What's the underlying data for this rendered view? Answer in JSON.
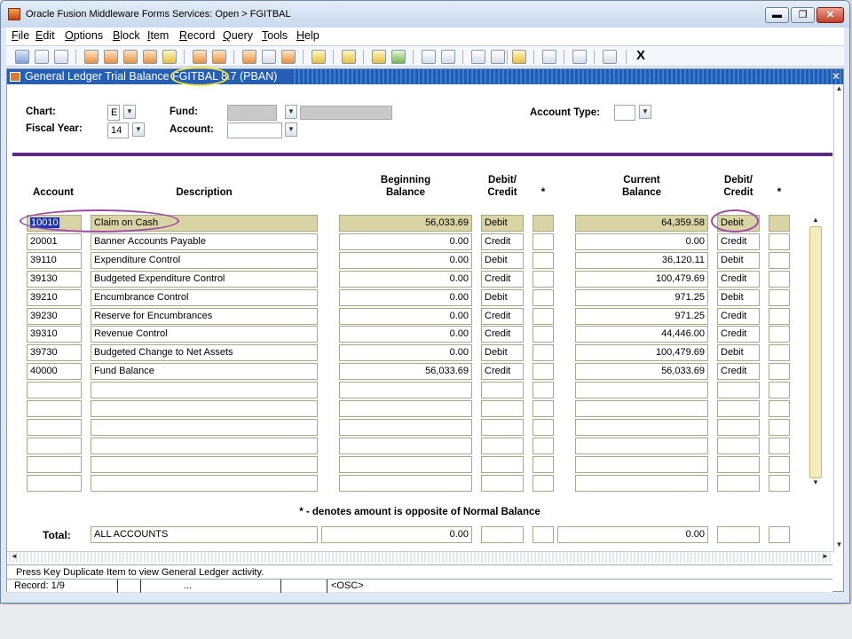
{
  "window": {
    "title": "Oracle Fusion Middleware Forms Services:  Open > FGITBAL",
    "min": "▬",
    "max": "❐",
    "close": "✕"
  },
  "menu": [
    "File",
    "Edit",
    "Options",
    "Block",
    "Item",
    "Record",
    "Query",
    "Tools",
    "Help"
  ],
  "toolbar": {
    "exit_label": "X"
  },
  "form": {
    "title": "General Ledger Trial Balance  FGITBAL  8.7  (PBAN)",
    "controls": "✕"
  },
  "header": {
    "chart_label": "Chart:",
    "chart_value": "E",
    "fiscal_year_label": "Fiscal Year:",
    "fiscal_year_value": "14",
    "fund_label": "Fund:",
    "fund_value": "",
    "fund_desc": "",
    "account_label": "Account:",
    "account_value": "",
    "account_type_label": "Account Type:",
    "account_type_value": ""
  },
  "columns": {
    "account": "Account",
    "description": "Description",
    "beginning_balance": "Beginning\nBalance",
    "debit_credit_1": "Debit/\nCredit",
    "star_1": "*",
    "current_balance": "Current\nBalance",
    "debit_credit_2": "Debit/\nCredit",
    "star_2": "*"
  },
  "rows": [
    {
      "account": "10010",
      "description": "Claim on Cash",
      "beg": "56,033.69",
      "dc1": "Debit",
      "cur": "64,359.58",
      "dc2": "Debit"
    },
    {
      "account": "20001",
      "description": "Banner Accounts Payable",
      "beg": "0.00",
      "dc1": "Credit",
      "cur": "0.00",
      "dc2": "Credit"
    },
    {
      "account": "39110",
      "description": "Expenditure Control",
      "beg": "0.00",
      "dc1": "Debit",
      "cur": "36,120.11",
      "dc2": "Debit"
    },
    {
      "account": "39130",
      "description": "Budgeted Expenditure Control",
      "beg": "0.00",
      "dc1": "Credit",
      "cur": "100,479.69",
      "dc2": "Credit"
    },
    {
      "account": "39210",
      "description": "Encumbrance Control",
      "beg": "0.00",
      "dc1": "Debit",
      "cur": "971.25",
      "dc2": "Debit"
    },
    {
      "account": "39230",
      "description": "Reserve for Encumbrances",
      "beg": "0.00",
      "dc1": "Credit",
      "cur": "971.25",
      "dc2": "Credit"
    },
    {
      "account": "39310",
      "description": "Revenue Control",
      "beg": "0.00",
      "dc1": "Credit",
      "cur": "44,446.00",
      "dc2": "Credit"
    },
    {
      "account": "39730",
      "description": "Budgeted Change to Net Assets",
      "beg": "0.00",
      "dc1": "Debit",
      "cur": "100,479.69",
      "dc2": "Debit"
    },
    {
      "account": "40000",
      "description": "Fund Balance",
      "beg": "56,033.69",
      "dc1": "Credit",
      "cur": "56,033.69",
      "dc2": "Credit"
    },
    {
      "account": "",
      "description": "",
      "beg": "",
      "dc1": "",
      "cur": "",
      "dc2": ""
    },
    {
      "account": "",
      "description": "",
      "beg": "",
      "dc1": "",
      "cur": "",
      "dc2": ""
    },
    {
      "account": "",
      "description": "",
      "beg": "",
      "dc1": "",
      "cur": "",
      "dc2": ""
    },
    {
      "account": "",
      "description": "",
      "beg": "",
      "dc1": "",
      "cur": "",
      "dc2": ""
    },
    {
      "account": "",
      "description": "",
      "beg": "",
      "dc1": "",
      "cur": "",
      "dc2": ""
    },
    {
      "account": "",
      "description": "",
      "beg": "",
      "dc1": "",
      "cur": "",
      "dc2": ""
    }
  ],
  "note": "* - denotes amount is opposite of Normal Balance",
  "totals": {
    "label": "Total:",
    "description": "ALL ACCOUNTS",
    "beg": "0.00",
    "cur": "0.00"
  },
  "status": {
    "hint": "Press Key Duplicate Item  to view General Ledger activity.",
    "record": "Record: 1/9",
    "ellipsis": "...",
    "osc": "<OSC>"
  },
  "icons": {
    "scroll_up": "▲",
    "scroll_down": "▼",
    "scroll_left": "◄",
    "scroll_right": "►",
    "lov": "▼"
  },
  "colors": {
    "highlight_yellow": "#f3e23a",
    "highlight_purple": "#a04aa8",
    "form_title": "#245fb5"
  }
}
